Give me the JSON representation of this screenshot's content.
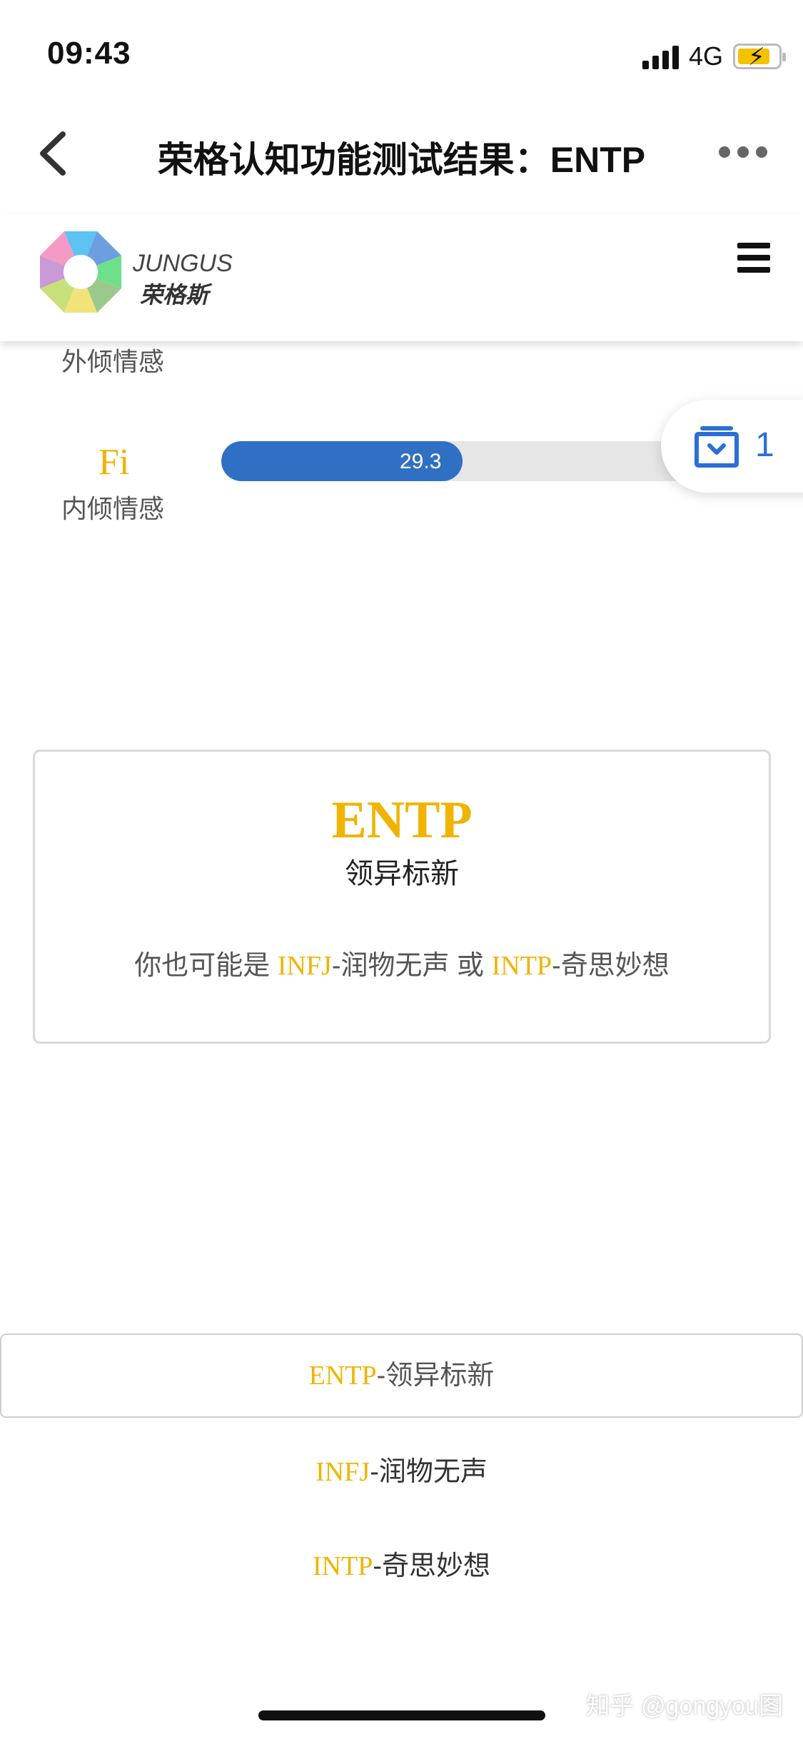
{
  "status_bar": {
    "time": "09:43",
    "network": "4G",
    "icons": [
      "signal-icon",
      "battery-charging-icon"
    ]
  },
  "nav": {
    "title": "荣格认知功能测试结果：ENTP",
    "back_icon": "chevron-left-icon",
    "more_icon": "more-dots-icon"
  },
  "site_header": {
    "brand_en": "JUNGUS",
    "brand_cn": "荣格斯",
    "menu_icon": "hamburger-icon"
  },
  "functions": {
    "partial_label": "外倾情感",
    "row": {
      "code": "Fi",
      "name": "内倾情感",
      "value_text": "29.3",
      "bar_fraction": 0.47
    }
  },
  "float_widget": {
    "icon": "clip-box-icon",
    "count": "1"
  },
  "result_card": {
    "type": "ENTP",
    "name": "领异标新",
    "alt_prefix": "你也可能是 ",
    "alt1_type": "INFJ",
    "alt1_name": "-润物无声",
    "alt_mid": " 或 ",
    "alt2_type": "INTP",
    "alt2_name": "-奇思妙想"
  },
  "type_list": [
    {
      "type": "ENTP",
      "name": "-领异标新",
      "active": true
    },
    {
      "type": "INFJ",
      "name": "-润物无声",
      "active": false
    },
    {
      "type": "INTP",
      "name": "-奇思妙想",
      "active": false
    }
  ],
  "watermark": "知乎 @gongyou图",
  "colors": {
    "accent_yellow": "#f0b400",
    "bar_blue": "#3070c4",
    "clip_blue": "#2a6fd6"
  }
}
